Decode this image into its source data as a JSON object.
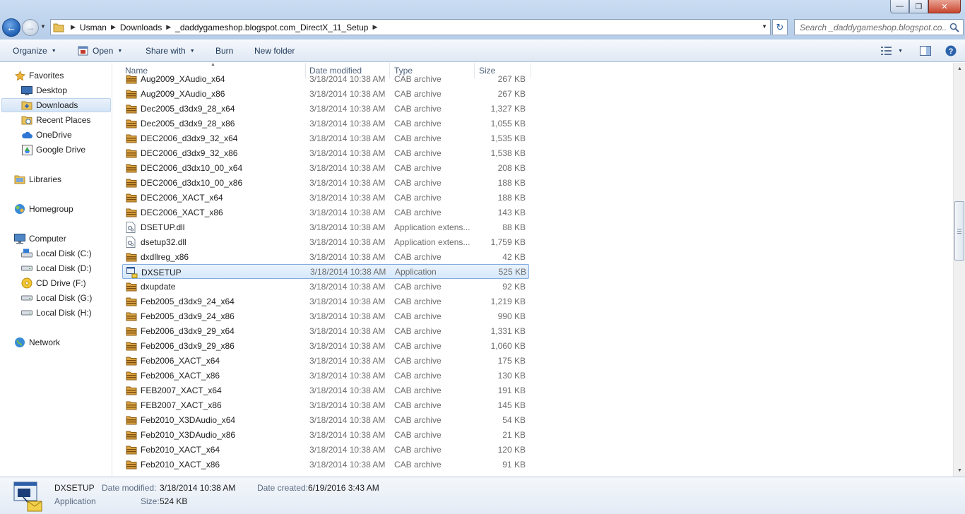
{
  "window": {
    "minimize_glyph": "—",
    "maximize_glyph": "❐",
    "close_glyph": "✕"
  },
  "address": {
    "crumbs": [
      "Usman",
      "Downloads",
      "_daddygameshop.blogspot.com_DirectX_11_Setup"
    ],
    "search_placeholder": "Search _daddygameshop.blogspot.co..."
  },
  "toolbar": {
    "organize": "Organize",
    "open": "Open",
    "share_with": "Share with",
    "burn": "Burn",
    "new_folder": "New folder"
  },
  "nav": {
    "favorites": "Favorites",
    "desktop": "Desktop",
    "downloads": "Downloads",
    "recent_places": "Recent Places",
    "onedrive": "OneDrive",
    "google_drive": "Google Drive",
    "libraries": "Libraries",
    "homegroup": "Homegroup",
    "computer": "Computer",
    "local_c": "Local Disk (C:)",
    "local_d": "Local Disk (D:)",
    "cd_f": "CD Drive (F:)",
    "local_g": "Local Disk (G:)",
    "local_h": "Local Disk (H:)",
    "network": "Network"
  },
  "columns": {
    "name": "Name",
    "date_modified": "Date modified",
    "type": "Type",
    "size": "Size"
  },
  "files": [
    {
      "name": "Aug2009_XAudio_x64",
      "date": "3/18/2014 10:38 AM",
      "type": "CAB archive",
      "size": "267 KB",
      "icon": "cab-archive-icon"
    },
    {
      "name": "Aug2009_XAudio_x86",
      "date": "3/18/2014 10:38 AM",
      "type": "CAB archive",
      "size": "267 KB",
      "icon": "cab-archive-icon"
    },
    {
      "name": "Dec2005_d3dx9_28_x64",
      "date": "3/18/2014 10:38 AM",
      "type": "CAB archive",
      "size": "1,327 KB",
      "icon": "cab-archive-icon"
    },
    {
      "name": "Dec2005_d3dx9_28_x86",
      "date": "3/18/2014 10:38 AM",
      "type": "CAB archive",
      "size": "1,055 KB",
      "icon": "cab-archive-icon"
    },
    {
      "name": "DEC2006_d3dx9_32_x64",
      "date": "3/18/2014 10:38 AM",
      "type": "CAB archive",
      "size": "1,535 KB",
      "icon": "cab-archive-icon"
    },
    {
      "name": "DEC2006_d3dx9_32_x86",
      "date": "3/18/2014 10:38 AM",
      "type": "CAB archive",
      "size": "1,538 KB",
      "icon": "cab-archive-icon"
    },
    {
      "name": "DEC2006_d3dx10_00_x64",
      "date": "3/18/2014 10:38 AM",
      "type": "CAB archive",
      "size": "208 KB",
      "icon": "cab-archive-icon"
    },
    {
      "name": "DEC2006_d3dx10_00_x86",
      "date": "3/18/2014 10:38 AM",
      "type": "CAB archive",
      "size": "188 KB",
      "icon": "cab-archive-icon"
    },
    {
      "name": "DEC2006_XACT_x64",
      "date": "3/18/2014 10:38 AM",
      "type": "CAB archive",
      "size": "188 KB",
      "icon": "cab-archive-icon"
    },
    {
      "name": "DEC2006_XACT_x86",
      "date": "3/18/2014 10:38 AM",
      "type": "CAB archive",
      "size": "143 KB",
      "icon": "cab-archive-icon"
    },
    {
      "name": "DSETUP.dll",
      "date": "3/18/2014 10:38 AM",
      "type": "Application extens...",
      "size": "88 KB",
      "icon": "dll-file-icon"
    },
    {
      "name": "dsetup32.dll",
      "date": "3/18/2014 10:38 AM",
      "type": "Application extens...",
      "size": "1,759 KB",
      "icon": "dll-file-icon"
    },
    {
      "name": "dxdllreg_x86",
      "date": "3/18/2014 10:38 AM",
      "type": "CAB archive",
      "size": "42 KB",
      "icon": "cab-archive-icon"
    },
    {
      "name": "DXSETUP",
      "date": "3/18/2014 10:38 AM",
      "type": "Application",
      "size": "525 KB",
      "icon": "application-icon",
      "selected": true
    },
    {
      "name": "dxupdate",
      "date": "3/18/2014 10:38 AM",
      "type": "CAB archive",
      "size": "92 KB",
      "icon": "cab-archive-icon"
    },
    {
      "name": "Feb2005_d3dx9_24_x64",
      "date": "3/18/2014 10:38 AM",
      "type": "CAB archive",
      "size": "1,219 KB",
      "icon": "cab-archive-icon"
    },
    {
      "name": "Feb2005_d3dx9_24_x86",
      "date": "3/18/2014 10:38 AM",
      "type": "CAB archive",
      "size": "990 KB",
      "icon": "cab-archive-icon"
    },
    {
      "name": "Feb2006_d3dx9_29_x64",
      "date": "3/18/2014 10:38 AM",
      "type": "CAB archive",
      "size": "1,331 KB",
      "icon": "cab-archive-icon"
    },
    {
      "name": "Feb2006_d3dx9_29_x86",
      "date": "3/18/2014 10:38 AM",
      "type": "CAB archive",
      "size": "1,060 KB",
      "icon": "cab-archive-icon"
    },
    {
      "name": "Feb2006_XACT_x64",
      "date": "3/18/2014 10:38 AM",
      "type": "CAB archive",
      "size": "175 KB",
      "icon": "cab-archive-icon"
    },
    {
      "name": "Feb2006_XACT_x86",
      "date": "3/18/2014 10:38 AM",
      "type": "CAB archive",
      "size": "130 KB",
      "icon": "cab-archive-icon"
    },
    {
      "name": "FEB2007_XACT_x64",
      "date": "3/18/2014 10:38 AM",
      "type": "CAB archive",
      "size": "191 KB",
      "icon": "cab-archive-icon"
    },
    {
      "name": "FEB2007_XACT_x86",
      "date": "3/18/2014 10:38 AM",
      "type": "CAB archive",
      "size": "145 KB",
      "icon": "cab-archive-icon"
    },
    {
      "name": "Feb2010_X3DAudio_x64",
      "date": "3/18/2014 10:38 AM",
      "type": "CAB archive",
      "size": "54 KB",
      "icon": "cab-archive-icon"
    },
    {
      "name": "Feb2010_X3DAudio_x86",
      "date": "3/18/2014 10:38 AM",
      "type": "CAB archive",
      "size": "21 KB",
      "icon": "cab-archive-icon"
    },
    {
      "name": "Feb2010_XACT_x64",
      "date": "3/18/2014 10:38 AM",
      "type": "CAB archive",
      "size": "120 KB",
      "icon": "cab-archive-icon"
    },
    {
      "name": "Feb2010_XACT_x86",
      "date": "3/18/2014 10:38 AM",
      "type": "CAB archive",
      "size": "91 KB",
      "icon": "cab-archive-icon"
    }
  ],
  "details": {
    "name": "DXSETUP",
    "type": "Application",
    "date_modified_label": "Date modified:",
    "date_modified": "3/18/2014 10:38 AM",
    "date_created_label": "Date created:",
    "date_created": "6/19/2016 3:43 AM",
    "size_label": "Size:",
    "size": "524 KB"
  },
  "colors": {
    "selection_border": "#84acdd",
    "accent": "#1e395b"
  }
}
